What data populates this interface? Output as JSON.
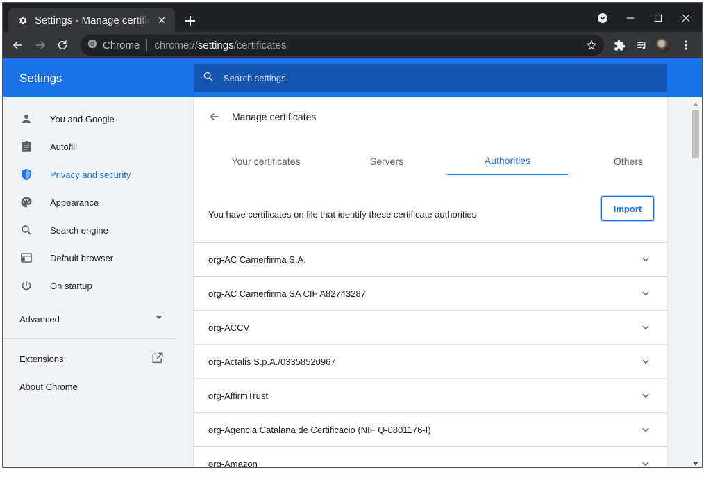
{
  "browser": {
    "tab_title": "Settings - Manage certificates",
    "url_site_label": "Chrome",
    "url_scheme": "chrome://",
    "url_host": "settings",
    "url_path": "/certificates"
  },
  "settings": {
    "title": "Settings",
    "search_placeholder": "Search settings"
  },
  "sidebar": {
    "items": [
      {
        "label": "You and Google",
        "icon": "person-icon"
      },
      {
        "label": "Autofill",
        "icon": "clipboard-icon"
      },
      {
        "label": "Privacy and security",
        "icon": "shield-icon",
        "active": true
      },
      {
        "label": "Appearance",
        "icon": "palette-icon"
      },
      {
        "label": "Search engine",
        "icon": "search-icon"
      },
      {
        "label": "Default browser",
        "icon": "browser-window-icon"
      },
      {
        "label": "On startup",
        "icon": "power-icon"
      }
    ],
    "advanced_label": "Advanced",
    "extensions_label": "Extensions",
    "about_label": "About Chrome"
  },
  "main": {
    "title": "Manage certificates",
    "tabs": [
      {
        "label": "Your certificates"
      },
      {
        "label": "Servers"
      },
      {
        "label": "Authorities",
        "active": true
      },
      {
        "label": "Others"
      }
    ],
    "info_text": "You have certificates on file that identify these certificate authorities",
    "import_label": "Import",
    "certificates": [
      "org-AC Camerfirma S.A.",
      "org-AC Camerfirma SA CIF A82743287",
      "org-ACCV",
      "org-Actalis S.p.A./03358520967",
      "org-AffirmTrust",
      "org-Agencia Catalana de Certificacio (NIF Q-0801176-I)",
      "org-Amazon"
    ]
  },
  "colors": {
    "accent": "#1a73e8",
    "header_bg": "#1a73e8",
    "search_bg": "#1557b0",
    "tabstrip_bg": "#202124",
    "toolbar_bg": "#35363a"
  }
}
